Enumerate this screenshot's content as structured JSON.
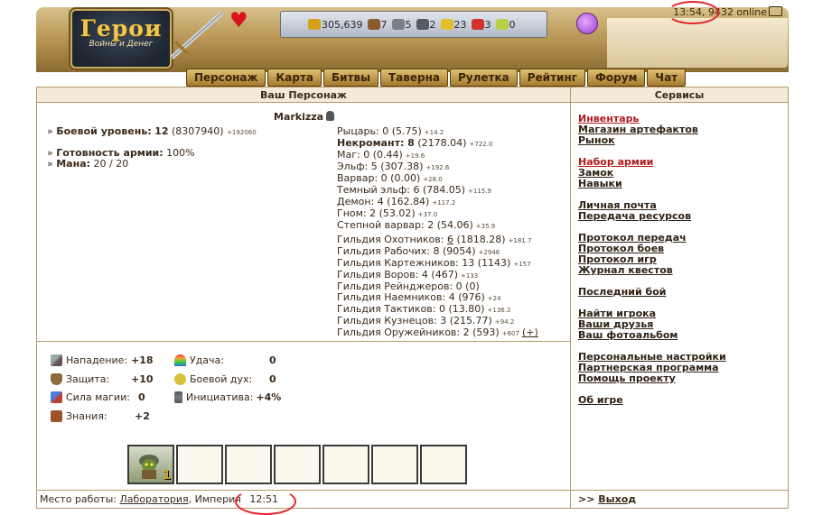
{
  "header": {
    "logo_title": "Герои",
    "logo_subtitle": "Войны и Денег",
    "time": "13:54",
    "online": ", 9432 online",
    "resources": [
      {
        "icon": "gold-icon",
        "value": "305,639",
        "color": "#d6a21a"
      },
      {
        "icon": "wood-icon",
        "value": "7",
        "color": "#8a5a2b"
      },
      {
        "icon": "ore-icon",
        "value": "5",
        "color": "#7a7f86"
      },
      {
        "icon": "mercury-icon",
        "value": "2",
        "color": "#555a63"
      },
      {
        "icon": "sulfur-icon",
        "value": "23",
        "color": "#e2c02a"
      },
      {
        "icon": "crystal-icon",
        "value": "3",
        "color": "#d0322f"
      },
      {
        "icon": "gems-icon",
        "value": "0",
        "color": "#b8d04a"
      }
    ],
    "nav": [
      "Персонаж",
      "Карта",
      "Битвы",
      "Таверна",
      "Рулетка",
      "Рейтинг",
      "Форум",
      "Чат"
    ]
  },
  "left": {
    "title": "Ваш Персонаж",
    "char_name": "Markizza",
    "combat_level_label": "Боевой уровень:",
    "combat_level": "12",
    "combat_exp": "(8307940)",
    "combat_exp_next": "+192060",
    "army_ready_label": "Готовность армии:",
    "army_ready": "100%",
    "mana_label": "Мана:",
    "mana": "20 / 20",
    "factions": [
      {
        "name": "Рыцарь: 0 (5.75)",
        "extra": "+14.2",
        "bold": false
      },
      {
        "name": "Некромант: 8",
        "rest": " (2178.04)",
        "extra": "+722.0",
        "bold": true
      },
      {
        "name": "Маг: 0 (0.44)",
        "extra": "+19.6",
        "bold": false
      },
      {
        "name": "Эльф: 5 (307.38)",
        "extra": "+192.6",
        "bold": false
      },
      {
        "name": "Варвар: 0 (0.00)",
        "extra": "+28.0",
        "bold": false
      },
      {
        "name": "Темный эльф: 6 (784.05)",
        "extra": "+115.9",
        "bold": false
      },
      {
        "name": "Демон: 4 (162.84)",
        "extra": "+117.2",
        "bold": false
      },
      {
        "name": "Гном: 2 (53.02)",
        "extra": "+37.0",
        "bold": false
      },
      {
        "name": "Степной варвар: 2 (54.06)",
        "extra": "+35.9",
        "bold": false
      }
    ],
    "guilds": [
      {
        "pre": "Гильдия Охотников: ",
        "link": "6",
        "post": " (1818.28)",
        "extra": "+181.7"
      },
      {
        "pre": "Гильдия Рабочих: 8 (9054)",
        "link": "",
        "post": "",
        "extra": "+2946"
      },
      {
        "pre": "Гильдия Картежников: 13 (1143)",
        "link": "",
        "post": "",
        "extra": "+157"
      },
      {
        "pre": "Гильдия Воров: 4 (467)",
        "link": "",
        "post": "",
        "extra": "+133"
      },
      {
        "pre": "Гильдия Рейнджеров: 0 (0)",
        "link": "",
        "post": "",
        "extra": ""
      },
      {
        "pre": "Гильдия Наемников: 4 (976)",
        "link": "",
        "post": "",
        "extra": "+24"
      },
      {
        "pre": "Гильдия Тактиков: 0 (13.80)",
        "link": "",
        "post": "",
        "extra": "+136.2"
      },
      {
        "pre": "Гильдия Кузнецов: 3 (215.77)",
        "link": "",
        "post": "",
        "extra": "+94.2"
      },
      {
        "pre": "Гильдия Оружейников: 2 (593)",
        "link": "",
        "post": "",
        "extra": "+607",
        "plus": "(+)"
      }
    ],
    "stats": {
      "attack_label": "Нападение:",
      "attack": "+18",
      "defense_label": "Защита:",
      "defense": "+10",
      "magic_label": "Сила магии:",
      "magic": "0",
      "knowledge_label": "Знания:",
      "knowledge": "+2",
      "luck_label": "Удача:",
      "luck": "0",
      "morale_label": "Боевой дух:",
      "morale": "0",
      "initiative_label": "Инициатива:",
      "initiative": "+4%"
    },
    "army_slot_count": "1",
    "workplace_label": "Место работы:",
    "workplace": "Лаборатория",
    "workplace_rest": ", Империя",
    "work_time": "12:51"
  },
  "right": {
    "title": "Сервисы",
    "logout_prefix": ">>",
    "logout": "Выход",
    "links": [
      [
        "Инвентарь",
        "Магазин артефактов",
        "Рынок"
      ],
      [
        "Набор армии",
        "Замок",
        "Навыки"
      ],
      [
        "Личная почта",
        "Передача ресурсов"
      ],
      [
        "Протокол передач",
        "Протокол боев",
        "Протокол игр",
        "Журнал квестов"
      ],
      [
        "Последний бой"
      ],
      [
        "Найти игрока",
        "Ваши друзья",
        "Ваш фотоальбом"
      ],
      [
        "Персональные настройки",
        "Партнерская программа",
        "Помощь проекту"
      ],
      [
        "Об игре"
      ]
    ]
  }
}
